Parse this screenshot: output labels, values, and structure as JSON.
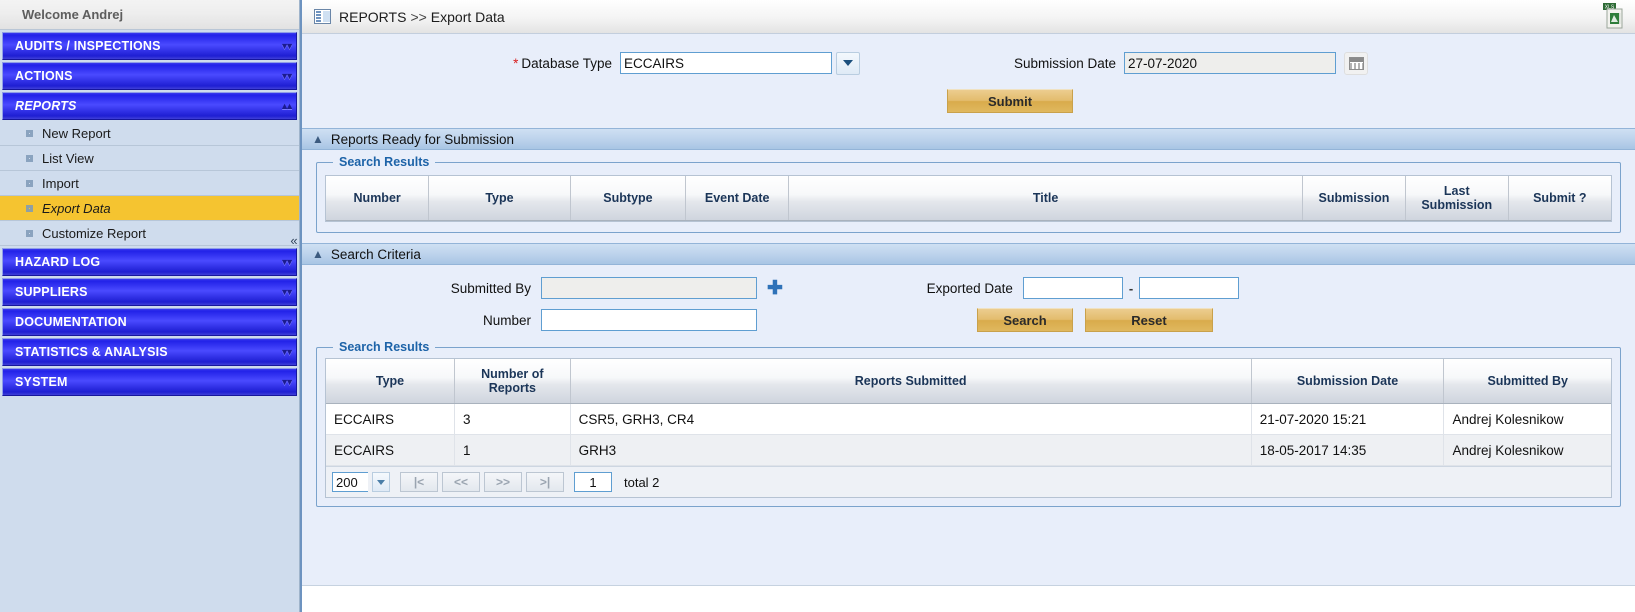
{
  "sidebar": {
    "welcome": "Welcome  Andrej",
    "collapse_icon": "«",
    "groups": [
      {
        "label": "AUDITS / INSPECTIONS",
        "icon": "chevron-double-down-icon",
        "chev": "»",
        "expanded": false,
        "items": []
      },
      {
        "label": "ACTIONS",
        "icon": "chevron-double-down-icon",
        "chev": "»",
        "expanded": false,
        "items": []
      },
      {
        "label": "REPORTS",
        "icon": "chevron-double-up-icon",
        "chev": "«",
        "expanded": true,
        "items": [
          {
            "label": "New Report",
            "selected": false
          },
          {
            "label": "List View",
            "selected": false
          },
          {
            "label": "Import",
            "selected": false
          },
          {
            "label": "Export Data",
            "selected": true
          },
          {
            "label": "Customize Report",
            "selected": false
          }
        ]
      },
      {
        "label": "HAZARD LOG",
        "icon": "chevron-double-down-icon",
        "chev": "»",
        "expanded": false,
        "items": []
      },
      {
        "label": "SUPPLIERS",
        "icon": "chevron-double-down-icon",
        "chev": "»",
        "expanded": false,
        "items": []
      },
      {
        "label": "DOCUMENTATION",
        "icon": "chevron-double-down-icon",
        "chev": "»",
        "expanded": false,
        "items": []
      },
      {
        "label": "STATISTICS & ANALYSIS",
        "icon": "chevron-double-down-icon",
        "chev": "»",
        "expanded": false,
        "items": []
      },
      {
        "label": "SYSTEM",
        "icon": "chevron-double-down-icon",
        "chev": "»",
        "expanded": false,
        "items": []
      }
    ]
  },
  "breadcrumb": {
    "icon": "panel-layout-icon",
    "root": "REPORTS",
    "separator": ">>",
    "current": "Export Data",
    "export_icon": "excel-export-icon"
  },
  "export_form": {
    "database_type_label": "Database Type",
    "required_marker": "*",
    "database_type_value": "ECCAIRS",
    "database_type_dropdown_icon": "chevron-down-icon",
    "submission_date_label": "Submission Date",
    "submission_date_value": "27-07-2020",
    "calendar_icon": "calendar-icon",
    "submit_label": "Submit"
  },
  "ready_section": {
    "title": "Reports Ready for Submission",
    "collapse_icon": "chevron-up-icon",
    "legend": "Search Results",
    "columns": [
      "Number",
      "Type",
      "Subtype",
      "Event Date",
      "Title",
      "Submission",
      "Last Submission",
      "Submit ?"
    ],
    "rows": []
  },
  "criteria_section": {
    "title": "Search Criteria",
    "collapse_icon": "chevron-up-icon",
    "submitted_by_label": "Submitted By",
    "submitted_by_value": "",
    "submitted_by_add_icon": "plus-icon",
    "number_label": "Number",
    "number_value": "",
    "exported_date_label": "Exported Date",
    "exported_date_from": "",
    "exported_date_to": "",
    "range_separator": "-",
    "search_label": "Search",
    "reset_label": "Reset"
  },
  "results_section": {
    "legend": "Search Results",
    "columns": [
      "Type",
      "Number of Reports",
      "Reports Submitted",
      "Submission Date",
      "Submitted By"
    ],
    "rows": [
      {
        "type": "ECCAIRS",
        "count": "3",
        "reports": "CSR5, GRH3, CR4",
        "date": "21-07-2020 15:21",
        "by": "Andrej Kolesnikow"
      },
      {
        "type": "ECCAIRS",
        "count": "1",
        "reports": "GRH3",
        "date": "18-05-2017 14:35",
        "by": "Andrej Kolesnikow"
      }
    ],
    "pager": {
      "page_size": "200",
      "page_size_icon": "chevron-down-icon",
      "first_label": "|<",
      "prev_label": "<<",
      "next_label": ">>",
      "last_label": ">|",
      "page_value": "1",
      "total_label": "total 2"
    }
  },
  "colors": {
    "accent_blue": "#2222e8",
    "selected_yellow": "#f5c430",
    "button_gold": "#e0b85f",
    "panel_bg": "#e8eefa",
    "required_red": "#d81e1e"
  }
}
